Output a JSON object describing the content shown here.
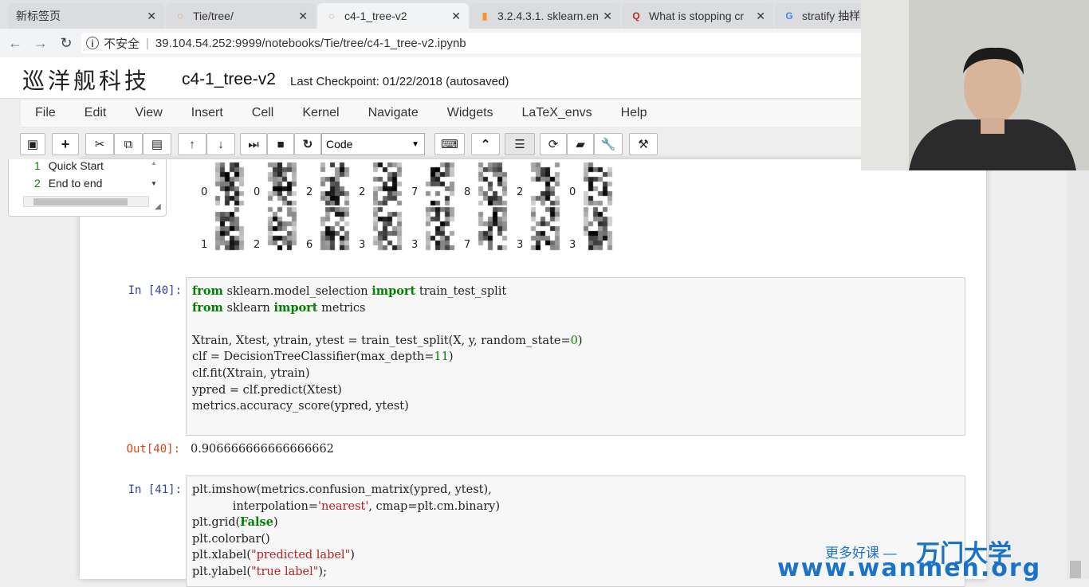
{
  "browser": {
    "tabs": [
      {
        "label": "新标签页",
        "icon": "none"
      },
      {
        "label": "Tie/tree/",
        "icon": "jupyter-icon"
      },
      {
        "label": "c4-1_tree-v2",
        "icon": "jupyter-icon"
      },
      {
        "label": "3.2.4.3.1. sklearn.en",
        "icon": "sklearn-icon"
      },
      {
        "label": "What is stopping cr",
        "icon": "quora-icon"
      },
      {
        "label": "stratify 抽样",
        "icon": "google-icon"
      }
    ],
    "security_label": "不安全",
    "url": "39.104.54.252:9999/notebooks/Tie/tree/c4-1_tree-v2.ipynb"
  },
  "header": {
    "logo": "巡洋舰科技",
    "notebook_name": "c4-1_tree-v2",
    "checkpoint": "Last Checkpoint: 01/22/2018 (autosaved)"
  },
  "menu": [
    "File",
    "Edit",
    "View",
    "Insert",
    "Cell",
    "Kernel",
    "Navigate",
    "Widgets",
    "LaTeX_envs",
    "Help"
  ],
  "toolbar": {
    "cell_type": "Code"
  },
  "toc": {
    "items": [
      {
        "num": "1",
        "label": "Quick Start"
      },
      {
        "num": "2",
        "label": "End to end"
      }
    ]
  },
  "digit_labels": {
    "row1": [
      "0",
      "0",
      "2",
      "2",
      "7",
      "8",
      "2",
      "0"
    ],
    "row2": [
      "1",
      "2",
      "6",
      "3",
      "3",
      "7",
      "3",
      "3"
    ]
  },
  "cells": {
    "cell40": {
      "prompt": "In [40]:",
      "out_prompt": "Out[40]:",
      "output": "0.906666666666666662"
    },
    "cell41": {
      "prompt": "In [41]:"
    }
  },
  "watermark": {
    "line1": "更多好课 —",
    "brand": "万门大学",
    "url": "www.wanmen.org"
  }
}
